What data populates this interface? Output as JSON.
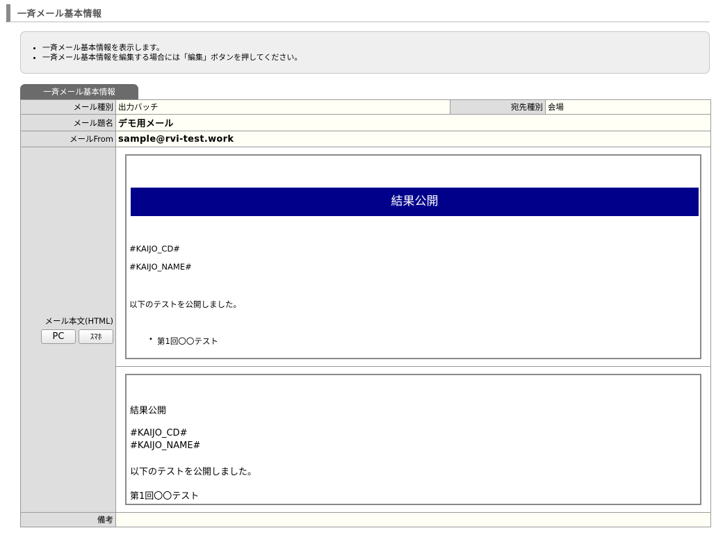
{
  "page_title": "一斉メール基本情報",
  "info": {
    "lines": [
      "一斉メール基本情報を表示します。",
      "一斉メール基本情報を編集する場合には「編集」ボタンを押してください。"
    ]
  },
  "tab_label": "一斉メール基本情報",
  "fields": {
    "mail_type_label": "メール種別",
    "mail_type_value": "出力バッチ",
    "dest_type_label": "宛先種別",
    "dest_type_value": "会場",
    "subject_label": "メール題名",
    "subject_value": "デモ用メール",
    "from_label": "メールFrom",
    "from_value": "sample@rvi-test.work",
    "body_label": "メール本文(HTML)",
    "note_label": "備考",
    "note_value": ""
  },
  "buttons": {
    "pc": "PC",
    "smartphone": "ｽﾏﾎ"
  },
  "html_preview": {
    "banner": "結果公開",
    "kaijo_cd": "#KAIJO_CD#",
    "kaijo_name": "#KAIJO_NAME#",
    "message": "以下のテストを公開しました。",
    "list_item": "第1回〇〇テスト"
  },
  "text_preview": {
    "heading": "結果公開",
    "kaijo_cd": "#KAIJO_CD#",
    "kaijo_name": "#KAIJO_NAME#",
    "message": "以下のテストを公開しました。",
    "test_name": "第1回〇〇テスト"
  },
  "colors": {
    "banner_bg": "#00008b",
    "tab_bg": "#6b6b6b",
    "label_bg": "#dedede",
    "value_bg": "#fffff5"
  }
}
